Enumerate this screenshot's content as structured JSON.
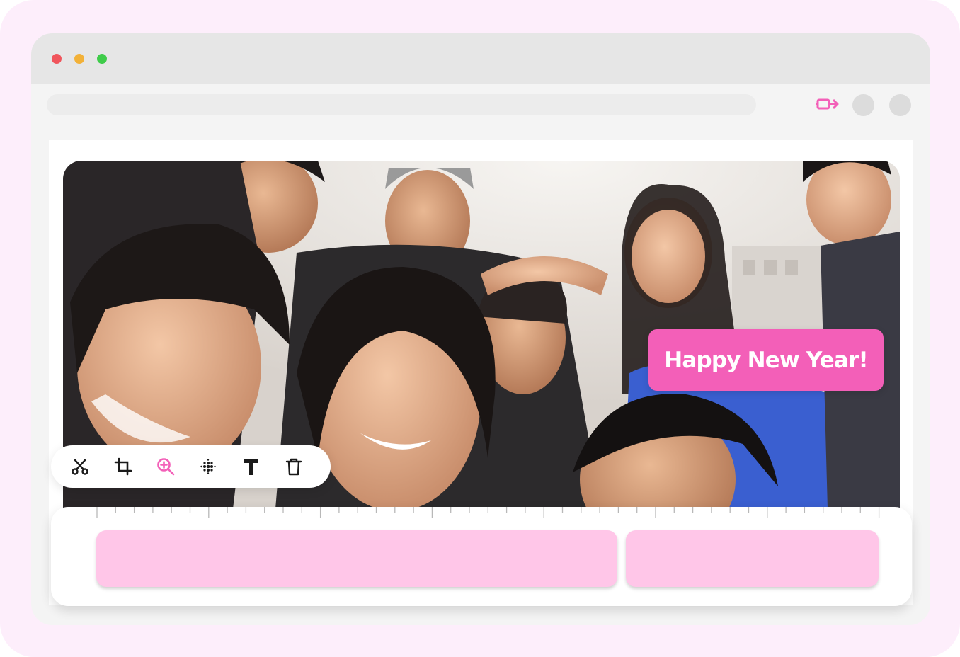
{
  "window": {
    "controls": [
      "close-dot",
      "minimize-dot",
      "maximize-dot"
    ]
  },
  "toolbar_icons": {
    "extension": "video-arrow-icon",
    "buttons": [
      "profile-button",
      "menu-button"
    ]
  },
  "editor": {
    "caption": "Happy New Year!",
    "photo_description_icon": "group-selfie-photo",
    "tools": [
      {
        "name": "scissors-icon",
        "active": false
      },
      {
        "name": "crop-icon",
        "active": false
      },
      {
        "name": "zoom-in-icon",
        "active": true
      },
      {
        "name": "blur-icon",
        "active": false
      },
      {
        "name": "text-icon",
        "active": false
      },
      {
        "name": "trash-icon",
        "active": false
      }
    ],
    "timeline": {
      "clips": 2
    }
  },
  "colors": {
    "accent": "#f35fb8",
    "clip": "#ffc6e8",
    "frame": "#fdeefb"
  }
}
